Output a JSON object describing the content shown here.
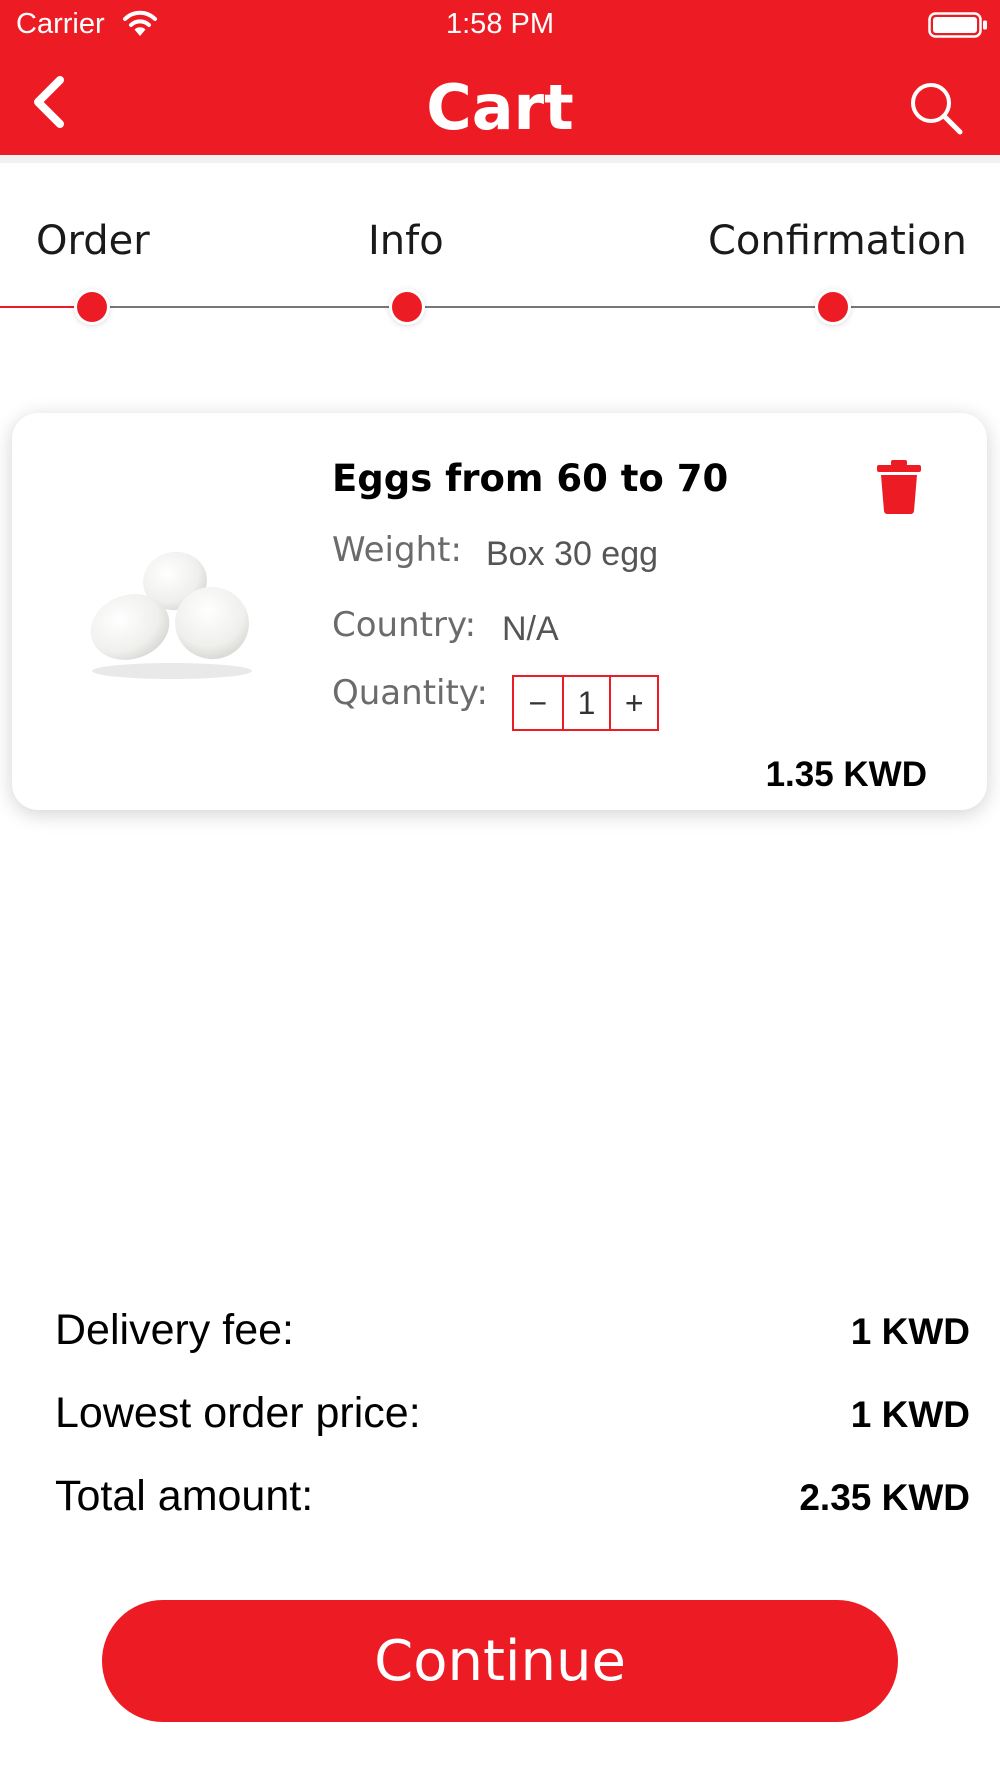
{
  "status_bar": {
    "carrier": "Carrier",
    "time": "1:58 PM",
    "icons": [
      "wifi-icon",
      "battery-icon"
    ]
  },
  "header": {
    "title": "Cart",
    "back_icon": "chevron-left-icon",
    "search_icon": "search-icon",
    "background_color": "#ed1c24"
  },
  "steps": {
    "items": [
      {
        "label": "Order"
      },
      {
        "label": "Info"
      },
      {
        "label": "Confirmation"
      }
    ]
  },
  "cart_item": {
    "image_icon": "eggs-image",
    "name": "Eggs from 60 to 70",
    "weight_label": "Weight:",
    "weight_value": "Box 30 egg",
    "country_label": "Country:",
    "country_value": "N/A",
    "quantity_label": "Quantity:",
    "quantity": "1",
    "minus_symbol": "−",
    "plus_symbol": "+",
    "price": "1.35 KWD",
    "delete_icon": "trash-icon"
  },
  "summary": {
    "delivery_fee_label": "Delivery fee:",
    "delivery_fee_value": "1 KWD",
    "lowest_order_label": "Lowest order price:",
    "lowest_order_value": "1 KWD",
    "total_label": "Total amount:",
    "total_value": "2.35 KWD"
  },
  "actions": {
    "continue_label": "Continue"
  },
  "colors": {
    "accent": "#ed1c24",
    "text": "#000000",
    "muted_text": "#6b6b6b"
  }
}
